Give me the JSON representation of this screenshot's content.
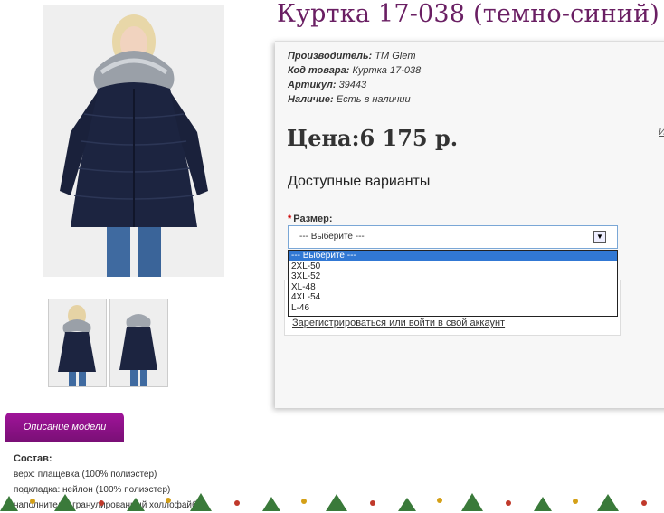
{
  "product": {
    "title": "Куртка 17-038 (темно-синий)",
    "meta": [
      {
        "label": "Производитель:",
        "value": "TM Glem"
      },
      {
        "label": "Код товара:",
        "value": "Куртка 17-038"
      },
      {
        "label": "Артикул:",
        "value": "39443"
      },
      {
        "label": "Наличие:",
        "value": "Есть в наличии"
      }
    ],
    "price": "Цена:6 175 р.",
    "side_link": "И"
  },
  "options": {
    "heading": "Доступные варианты",
    "required_mark": "*",
    "size_label": "Размер:",
    "selected": "--- Выберите ---",
    "list": [
      "--- Выберите ---",
      "2XL-50",
      "3XL-52",
      "XL-48",
      "4XL-54",
      "L-46"
    ]
  },
  "account": {
    "register_link": "Зарегистрироваться или войти в свой аккаунт"
  },
  "tabs": {
    "description": "Описание модели"
  },
  "description": {
    "heading": "Состав:",
    "lines": [
      "верх: плащевка (100% полиэстер)",
      "подкладка: нейлон (100% полиэстер)",
      "наполнитель: гранулированный холлофайбер"
    ]
  },
  "colors": {
    "title": "#6a1f63",
    "tab": "#8b1287",
    "jacket": "#1c2440",
    "selected_option": "#3178d4"
  }
}
